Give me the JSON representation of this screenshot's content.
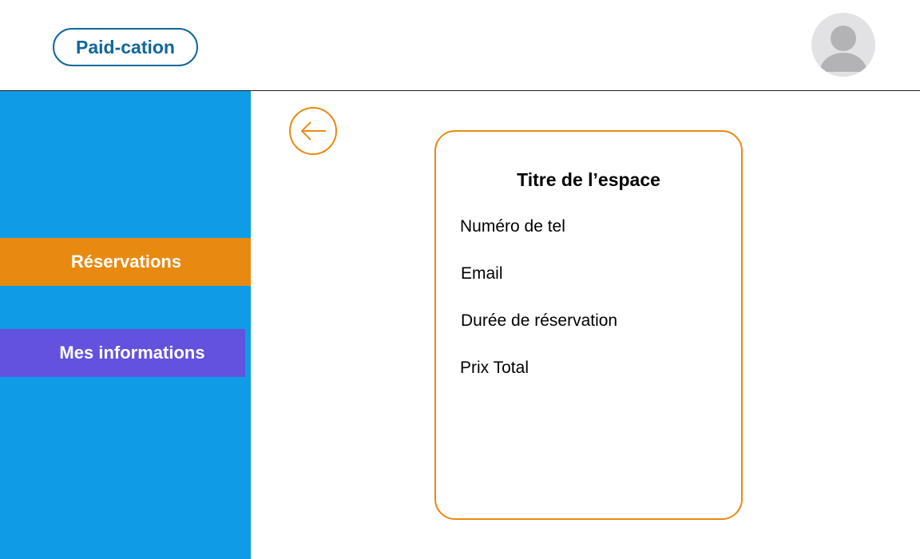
{
  "header": {
    "logo_label": "Paid-cation",
    "avatar_icon": "user-avatar-icon"
  },
  "sidebar": {
    "items": [
      {
        "label": "Réservations",
        "active": true,
        "color": "#e98a10"
      },
      {
        "label": "Mes informations",
        "active": false,
        "color": "#6252dd"
      }
    ],
    "background": "#0f9ce6"
  },
  "main": {
    "back_icon": "arrow-left-icon",
    "card": {
      "title": "Titre de l’espace",
      "fields": [
        "Numéro de tel",
        "Email",
        "Durée de réservation",
        "Prix Total"
      ],
      "border_color": "#e98a10"
    }
  },
  "colors": {
    "brand": "#106799",
    "accent": "#e98a10",
    "sidebar": "#0f9ce6",
    "secondary": "#6252dd"
  }
}
